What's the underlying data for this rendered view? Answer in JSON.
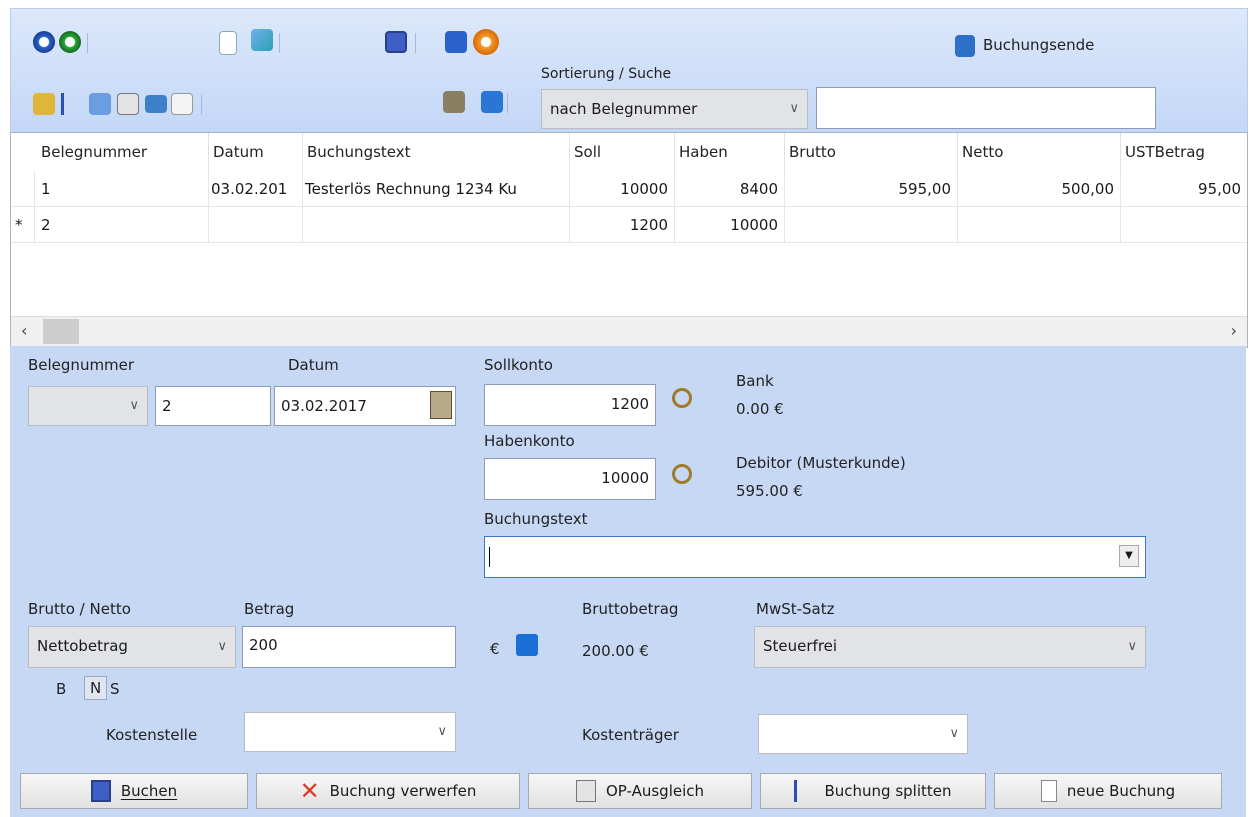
{
  "toolbar": {
    "buchungsende_label": "Buchungsende",
    "sort_label": "Sortierung / Suche",
    "sort_value": "nach Belegnummer",
    "search_value": ""
  },
  "grid": {
    "columns": [
      "Belegnummer",
      "Datum",
      "Buchungstext",
      "Soll",
      "Haben",
      "Brutto",
      "Netto",
      "USTBetrag"
    ],
    "rows": [
      {
        "marker": "",
        "belegnummer": "1",
        "datum": "03.02.201",
        "buchungstext": "Testerlös Rechnung 1234 Ku",
        "soll": "10000",
        "haben": "8400",
        "brutto": "595,00",
        "netto": "500,00",
        "ust": "95,00"
      },
      {
        "marker": "*",
        "belegnummer": "2",
        "datum": "",
        "buchungstext": "",
        "soll": "1200",
        "haben": "10000",
        "brutto": "",
        "netto": "",
        "ust": ""
      }
    ]
  },
  "form": {
    "belegnummer_label": "Belegnummer",
    "belegnummer_prefix": "",
    "belegnummer_value": "2",
    "datum_label": "Datum",
    "datum_value": "03.02.2017",
    "sollkonto_label": "Sollkonto",
    "sollkonto_value": "1200",
    "soll_name": "Bank",
    "soll_amount": "0.00 €",
    "habenkonto_label": "Habenkonto",
    "habenkonto_value": "10000",
    "haben_name": "Debitor (Musterkunde)",
    "haben_amount": "595.00 €",
    "buchungstext_label": "Buchungstext",
    "buchungstext_value": "",
    "bruttonetto_label": "Brutto / Netto",
    "bruttonetto_value": "Nettobetrag",
    "betrag_label": "Betrag",
    "betrag_value": "200",
    "currency": "€",
    "bruttobetrag_label": "Bruttobetrag",
    "bruttobetrag_value": "200.00 €",
    "mwst_label": "MwSt-Satz",
    "mwst_value": "Steuerfrei",
    "mode_b": "B",
    "mode_n": "N",
    "mode_s": "S",
    "kostenstelle_label": "Kostenstelle",
    "kostenstelle_value": "",
    "kostentraeger_label": "Kostenträger",
    "kostentraeger_value": ""
  },
  "buttons": {
    "buchen": "Buchen",
    "verwerfen": "Buchung verwerfen",
    "op": "OP-Ausgleich",
    "splitten": "Buchung splitten",
    "neue": "neue Buchung"
  },
  "colors": {
    "toolbar_bg": "#c3d7f6",
    "form_bg": "#c6d8f4",
    "accent_blue": "#1a6fd6"
  }
}
